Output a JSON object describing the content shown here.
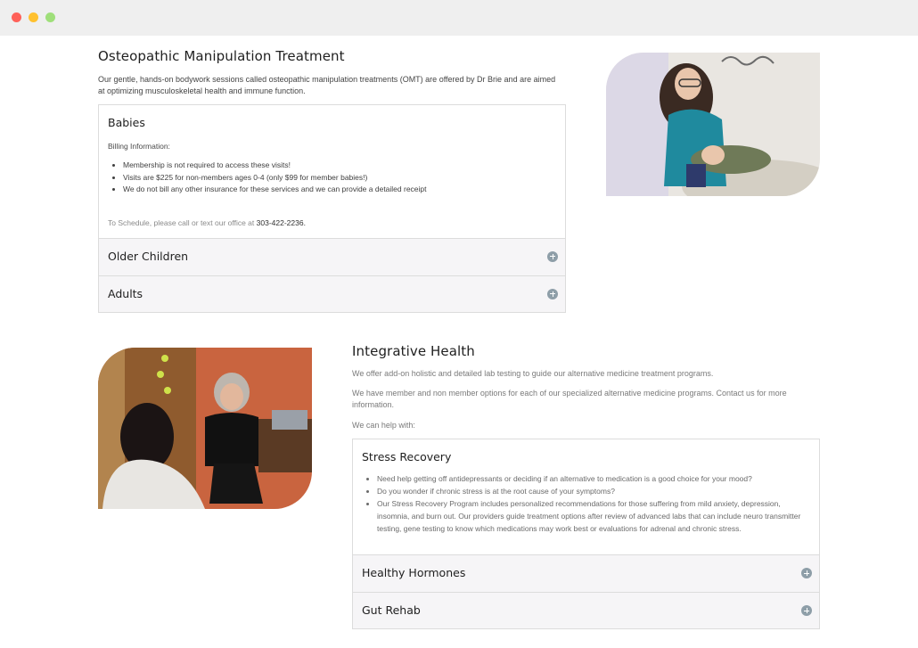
{
  "omt": {
    "title": "Osteopathic Manipulation Treatment",
    "intro": "Our gentle, hands-on bodywork sessions called osteopathic manipulation treatments (OMT) are offered by Dr Brie and are aimed at optimizing musculoskeletal health and immune function.",
    "babies": {
      "title": "Babies",
      "billing_label": "Billing Information:",
      "bullets": [
        "Membership is not required to access these visits!",
        "Visits are $225 for non-members ages 0-4 (only $99 for member babies!)",
        "We do not bill any other insurance for these services and we can provide a detailed receipt"
      ],
      "schedule_prefix": "To Schedule, please call or text our office at ",
      "schedule_phone": "303-422-2236."
    },
    "collapsed": [
      {
        "title": "Older Children"
      },
      {
        "title": "Adults"
      }
    ]
  },
  "integrative": {
    "title": "Integrative Health",
    "paragraphs": [
      "We offer add-on holistic and detailed lab testing to guide our alternative medicine treatment programs.",
      "We have member and non member options for each of our specialized alternative medicine programs. Contact us for more information.",
      "We can help with:"
    ],
    "stress": {
      "title": "Stress Recovery",
      "bullets": [
        "Need help getting off antidepressants or deciding if an alternative to medication is a good choice for your mood?",
        "Do you wonder if chronic stress is at the root cause of your symptoms?",
        "Our Stress Recovery Program includes personalized recommendations for those suffering from mild anxiety, depression, insomnia, and burn out. Our providers guide treatment options after review of advanced labs that can include neuro transmitter testing, gene testing to know which medications may work best or evaluations for adrenal and chronic stress."
      ]
    },
    "collapsed": [
      {
        "title": "Healthy Hormones"
      },
      {
        "title": "Gut Rehab"
      }
    ]
  },
  "colors": {
    "accordion_bg": "#f6f5f7",
    "plus_icon": "#8e9ea8",
    "border": "#dcdcdc"
  }
}
